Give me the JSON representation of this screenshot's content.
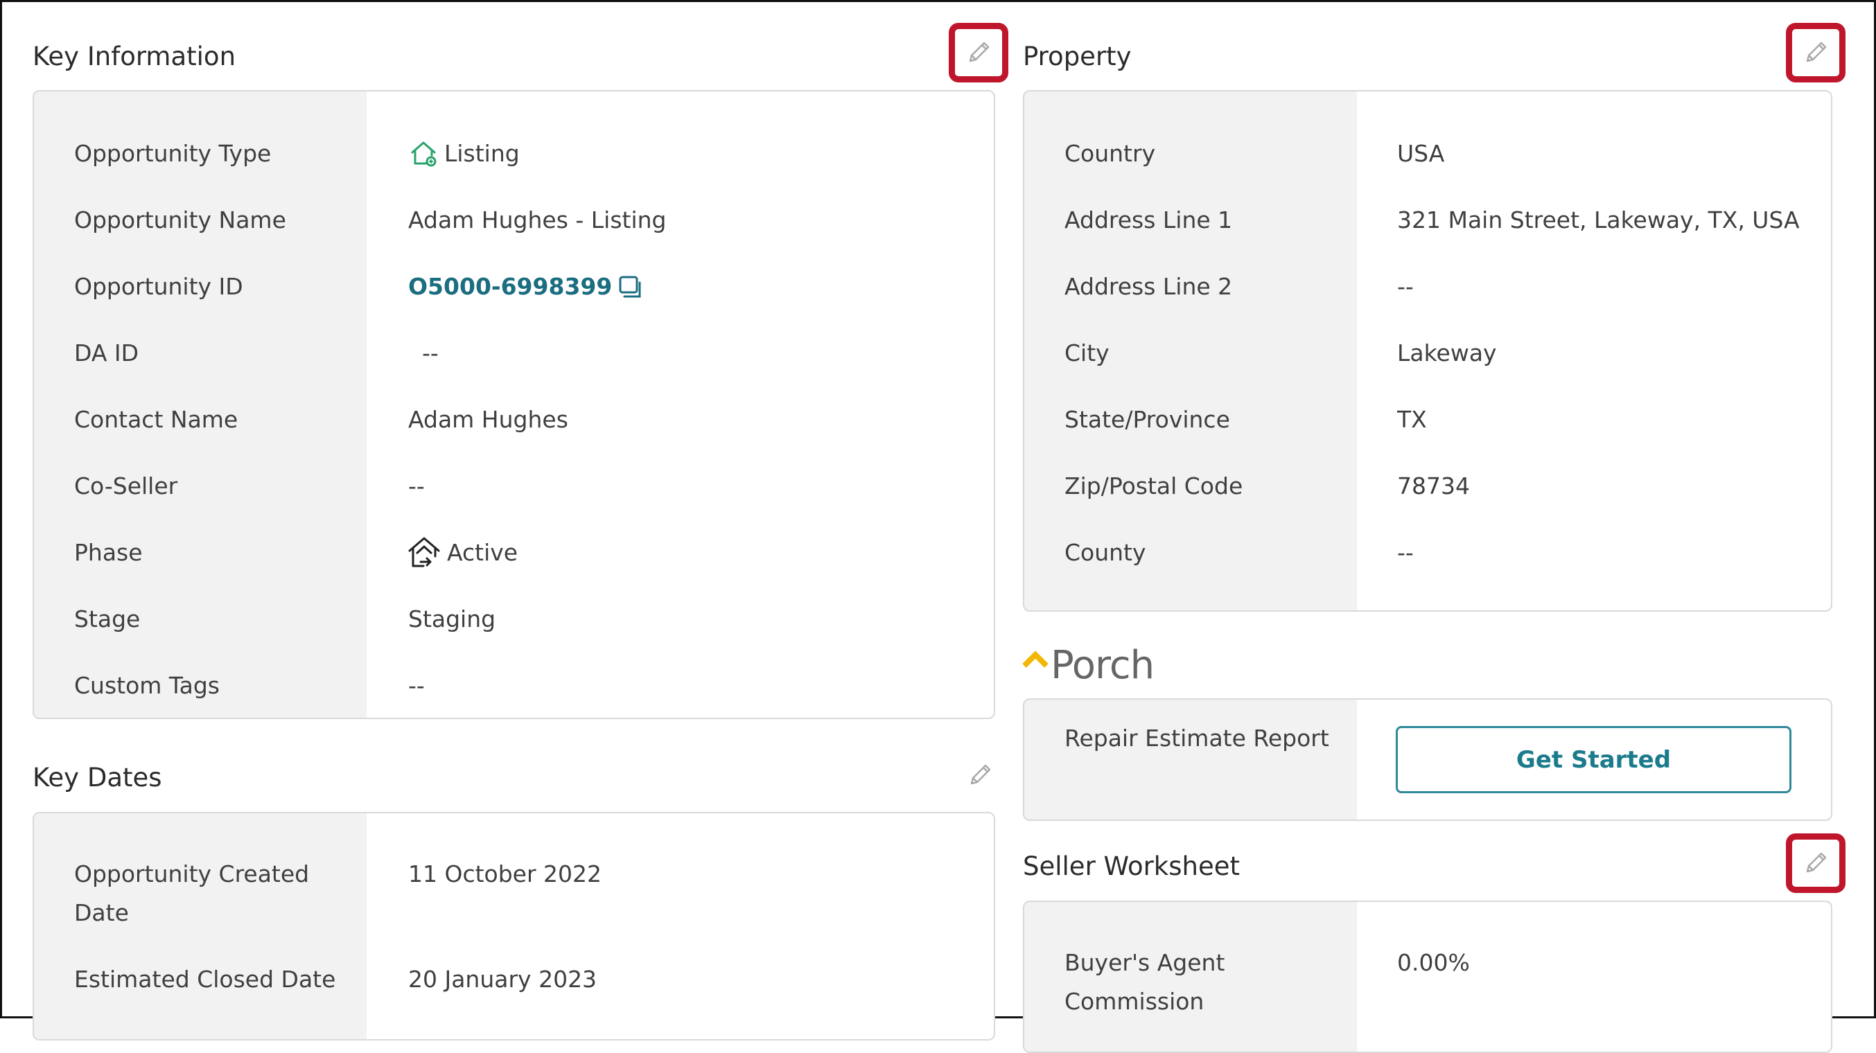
{
  "key_info": {
    "title": "Key Information",
    "rows": [
      {
        "label": "Opportunity Type",
        "value": "Listing"
      },
      {
        "label": "Opportunity Name",
        "value": "Adam Hughes - Listing"
      },
      {
        "label": "Opportunity ID",
        "value": "O5000-6998399"
      },
      {
        "label": "DA ID",
        "value": "--"
      },
      {
        "label": "Contact Name",
        "value": "Adam Hughes"
      },
      {
        "label": "Co-Seller",
        "value": "--"
      },
      {
        "label": "Phase",
        "value": "Active"
      },
      {
        "label": "Stage",
        "value": "Staging"
      },
      {
        "label": "Custom Tags",
        "value": "--"
      }
    ]
  },
  "key_dates": {
    "title": "Key Dates",
    "rows": [
      {
        "label_line1": "Opportunity Created",
        "label_line2": "Date",
        "value": "11 October 2022"
      },
      {
        "label": "Estimated Closed Date",
        "value": "20 January 2023"
      }
    ]
  },
  "property": {
    "title": "Property",
    "rows": [
      {
        "label": "Country",
        "value": "USA"
      },
      {
        "label": "Address Line 1",
        "value": "321 Main Street, Lakeway, TX, USA"
      },
      {
        "label": "Address Line 2",
        "value": "--"
      },
      {
        "label": "City",
        "value": "Lakeway"
      },
      {
        "label": "State/Province",
        "value": "TX"
      },
      {
        "label": "Zip/Postal Code",
        "value": "78734"
      },
      {
        "label": "County",
        "value": "--"
      }
    ]
  },
  "porch": {
    "logo_text": "Porch",
    "row_label": "Repair Estimate Report",
    "button_label": "Get Started"
  },
  "seller_worksheet": {
    "title": "Seller Worksheet",
    "rows": [
      {
        "label_line1": "Buyer's Agent",
        "label_line2": "Commission",
        "value": "0.00%"
      }
    ]
  },
  "colors": {
    "highlight_border": "#c0162c",
    "link": "#1b6d80",
    "button_accent": "#2e8a99",
    "listing_icon": "#27a36b",
    "porch_chevron": "#f2b705"
  },
  "icons": [
    "pencil-icon",
    "house-listing-icon",
    "copy-icon",
    "house-active-icon",
    "porch-chevron-icon"
  ]
}
